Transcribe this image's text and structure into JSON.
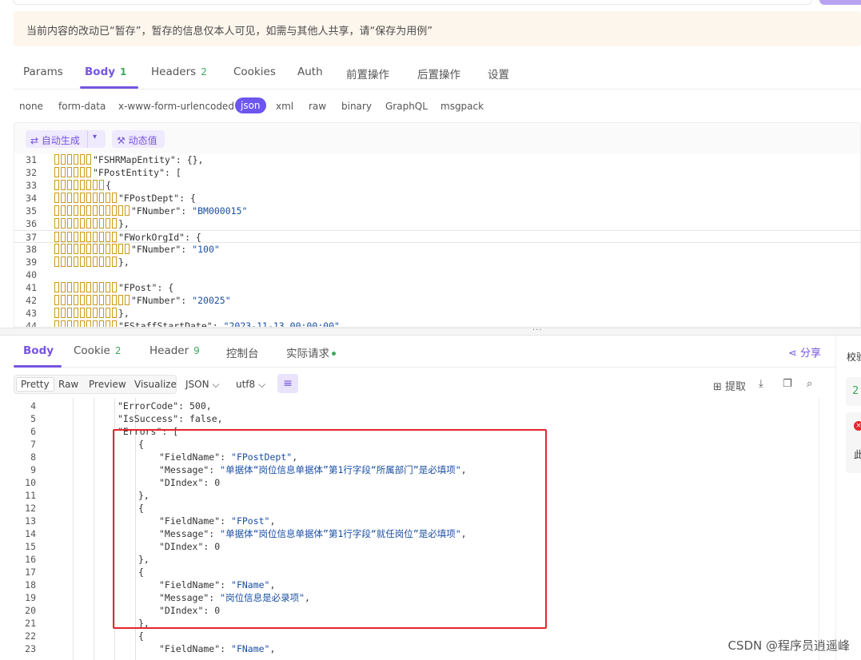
{
  "notice": "当前内容的改动已“暂存”，暂存的信息仅本人可见，如需与其他人共享，请“保存为用例”",
  "request_tabs": [
    {
      "label": "Params",
      "count": ""
    },
    {
      "label": "Body",
      "count": "1"
    },
    {
      "label": "Headers",
      "count": "2"
    },
    {
      "label": "Cookies",
      "count": ""
    },
    {
      "label": "Auth",
      "count": ""
    },
    {
      "label": "前置操作",
      "count": ""
    },
    {
      "label": "后置操作",
      "count": ""
    },
    {
      "label": "设置",
      "count": ""
    }
  ],
  "body_types": [
    "none",
    "form-data",
    "x-www-form-urlencoded",
    "json",
    "xml",
    "raw",
    "binary",
    "GraphQL",
    "msgpack"
  ],
  "editor_toolbar": {
    "auto_generate": "自动生成",
    "dynamic_value": "动态值"
  },
  "request_code": [
    {
      "ln": "31",
      "ws": 6,
      "text": "\"FSHRMapEntity\": {},"
    },
    {
      "ln": "32",
      "ws": 6,
      "text": "\"FPostEntity\": ["
    },
    {
      "ln": "33",
      "ws": 8,
      "text": "{"
    },
    {
      "ln": "34",
      "ws": 10,
      "text": "\"FPostDept\": {"
    },
    {
      "ln": "35",
      "ws": 12,
      "text": "\"FNumber\": ",
      "str": "\"BM000015\""
    },
    {
      "ln": "36",
      "ws": 10,
      "text": "},"
    },
    {
      "ln": "37",
      "ws": 10,
      "text": "\"FWorkOrgId\": {"
    },
    {
      "ln": "38",
      "ws": 12,
      "text": "\"FNumber\": ",
      "str": "\"100\""
    },
    {
      "ln": "39",
      "ws": 10,
      "text": "},"
    },
    {
      "ln": "40",
      "ws": 0,
      "text": ""
    },
    {
      "ln": "41",
      "ws": 10,
      "text": "\"FPost\": {"
    },
    {
      "ln": "42",
      "ws": 12,
      "text": "\"FNumber\": ",
      "str": "\"20025\""
    },
    {
      "ln": "43",
      "ws": 10,
      "text": "},"
    },
    {
      "ln": "44",
      "ws": 10,
      "text": "\"FStaffStartDate\": ",
      "str": "\"2023-11-13 00:00:00\"",
      "tail": ","
    }
  ],
  "response_tabs": [
    {
      "label": "Body",
      "count": ""
    },
    {
      "label": "Cookie",
      "count": "2"
    },
    {
      "label": "Header",
      "count": "9"
    },
    {
      "label": "控制台",
      "count": ""
    },
    {
      "label": "实际请求",
      "count": ""
    }
  ],
  "share_label": "分享",
  "view_modes": [
    "Pretty",
    "Raw",
    "Preview",
    "Visualize"
  ],
  "format_select": "JSON",
  "encoding_select": "utf8",
  "extract_label": "提取",
  "response_code": [
    {
      "ln": "4",
      "indent": 3,
      "text": "\"ErrorCode\": 500,"
    },
    {
      "ln": "5",
      "indent": 3,
      "text": "\"IsSuccess\": false,"
    },
    {
      "ln": "6",
      "indent": 3,
      "text": "\"Errors\": ["
    },
    {
      "ln": "7",
      "indent": 4,
      "text": "{"
    },
    {
      "ln": "8",
      "indent": 5,
      "text": "\"FieldName\": ",
      "str": "\"FPostDept\"",
      "tail": ","
    },
    {
      "ln": "9",
      "indent": 5,
      "text": "\"Message\": ",
      "str": "\"单据体“岗位信息单据体”第1行字段“所属部门”是必填项\"",
      "tail": ","
    },
    {
      "ln": "10",
      "indent": 5,
      "text": "\"DIndex\": 0"
    },
    {
      "ln": "11",
      "indent": 4,
      "text": "},"
    },
    {
      "ln": "12",
      "indent": 4,
      "text": "{"
    },
    {
      "ln": "13",
      "indent": 5,
      "text": "\"FieldName\": ",
      "str": "\"FPost\"",
      "tail": ","
    },
    {
      "ln": "14",
      "indent": 5,
      "text": "\"Message\": ",
      "str": "\"单据体“岗位信息单据体”第1行字段“就任岗位”是必填项\"",
      "tail": ","
    },
    {
      "ln": "15",
      "indent": 5,
      "text": "\"DIndex\": 0"
    },
    {
      "ln": "16",
      "indent": 4,
      "text": "},"
    },
    {
      "ln": "17",
      "indent": 4,
      "text": "{"
    },
    {
      "ln": "18",
      "indent": 5,
      "text": "\"FieldName\": ",
      "str": "\"FName\"",
      "tail": ","
    },
    {
      "ln": "19",
      "indent": 5,
      "text": "\"Message\": ",
      "str": "\"岗位信息是必录项\"",
      "tail": ","
    },
    {
      "ln": "20",
      "indent": 5,
      "text": "\"DIndex\": 0"
    },
    {
      "ln": "21",
      "indent": 4,
      "text": "},"
    },
    {
      "ln": "22",
      "indent": 4,
      "text": "{"
    },
    {
      "ln": "23",
      "indent": 5,
      "text": "\"FieldName\": ",
      "str": "\"FName\"",
      "tail": ","
    }
  ],
  "right_panel": {
    "label": "校验",
    "value": "2",
    "error_mark": "×",
    "char": "此"
  },
  "watermark": "CSDN @程序员逍遥峰",
  "colors": {
    "accent": "#7655e0",
    "json_pill": "#6c56ef",
    "count_green": "#3fa85e",
    "error_box": "#e3262b",
    "notice_bg": "#fdf6ec",
    "string": "#1a4fa3"
  }
}
